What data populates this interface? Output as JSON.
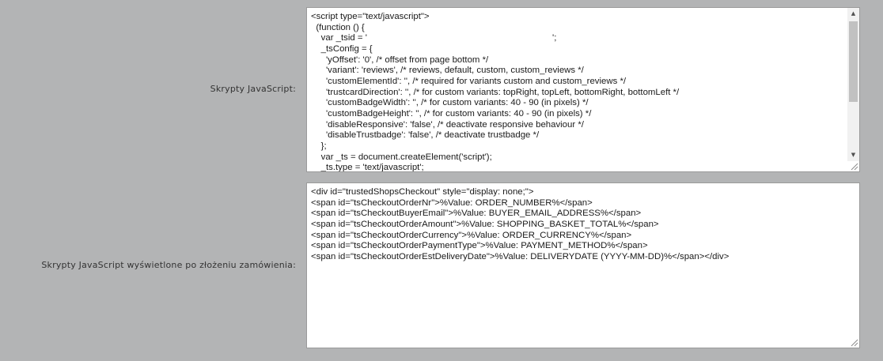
{
  "fields": [
    {
      "label": "Skrypty JavaScript:",
      "lines": [
        "<script type=\"text/javascript\">",
        "  (function () {",
        "    var _tsid = '                                                                          ';",
        "    _tsConfig = {",
        "      'yOffset': '0', /* offset from page bottom */",
        "      'variant': 'reviews', /* reviews, default, custom, custom_reviews */",
        "      'customElementId': '', /* required for variants custom and custom_reviews */",
        "      'trustcardDirection': '', /* for custom variants: topRight, topLeft, bottomRight, bottomLeft */",
        "      'customBadgeWidth': '', /* for custom variants: 40 - 90 (in pixels) */",
        "      'customBadgeHeight': '', /* for custom variants: 40 - 90 (in pixels) */",
        "      'disableResponsive': 'false', /* deactivate responsive behaviour */",
        "      'disableTrustbadge': 'false', /* deactivate trustbadge */",
        "    };",
        "    var _ts = document.createElement('script');",
        "    _ts.type = 'text/javascript';"
      ]
    },
    {
      "label": "Skrypty JavaScript wyświetlone po złożeniu zamówienia:",
      "lines": [
        "<div id=\"trustedShopsCheckout\" style=\"display: none;\">",
        "<span id=\"tsCheckoutOrderNr\">%Value: ORDER_NUMBER%</span>",
        "<span id=\"tsCheckoutBuyerEmail\">%Value: BUYER_EMAIL_ADDRESS%</span>",
        "<span id=\"tsCheckoutOrderAmount\">%Value: SHOPPING_BASKET_TOTAL%</span>",
        "<span id=\"tsCheckoutOrderCurrency\">%Value: ORDER_CURRENCY%</span>",
        "<span id=\"tsCheckoutOrderPaymentType\">%Value: PAYMENT_METHOD%</span>",
        "<span id=\"tsCheckoutOrderEstDeliveryDate\">%Value: DELIVERYDATE (YYYY-MM-DD)%</span></div>"
      ]
    }
  ]
}
